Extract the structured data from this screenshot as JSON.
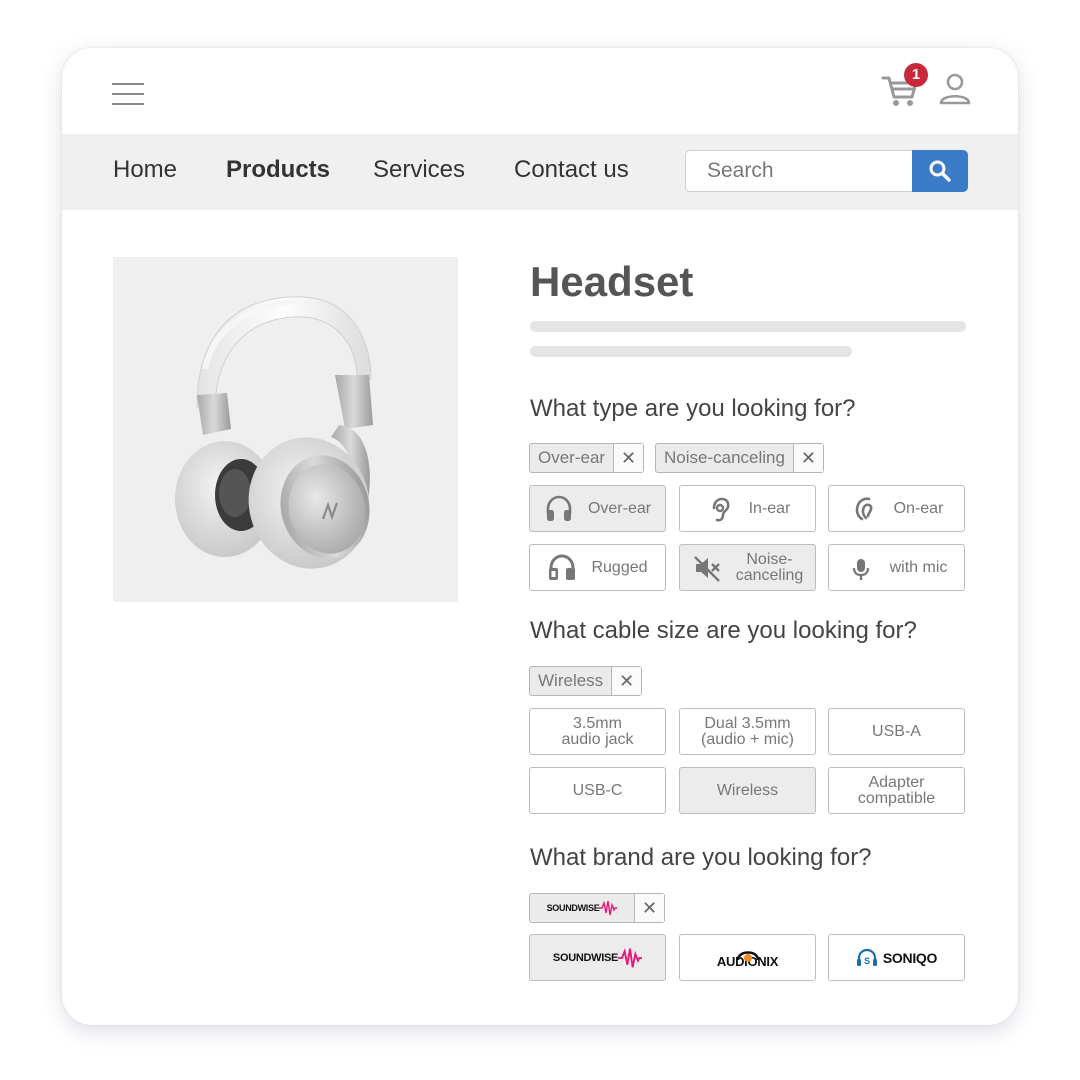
{
  "header": {
    "cart_count": "1"
  },
  "nav": {
    "items": [
      "Home",
      "Products",
      "Services",
      "Contact us"
    ],
    "active": "Products",
    "search_placeholder": "Search"
  },
  "product": {
    "title": "Headset"
  },
  "filters": {
    "type": {
      "question": "What type are you looking for?",
      "chips": [
        "Over-ear",
        "Noise-canceling"
      ],
      "options": [
        {
          "label": "Over-ear",
          "icon": "headphones-icon",
          "selected": true
        },
        {
          "label": "In-ear",
          "icon": "in-ear-icon",
          "selected": false
        },
        {
          "label": "On-ear",
          "icon": "on-ear-icon",
          "selected": false
        },
        {
          "label": "Rugged",
          "icon": "rugged-headphones-icon",
          "selected": false
        },
        {
          "label": "Noise-\ncanceling",
          "icon": "noise-canceling-icon",
          "selected": true
        },
        {
          "label": "with mic",
          "icon": "microphone-icon",
          "selected": false
        }
      ]
    },
    "cable": {
      "question": "What cable size are you looking for?",
      "chips": [
        "Wireless"
      ],
      "options": [
        {
          "label": "3.5mm\naudio jack",
          "selected": false
        },
        {
          "label": "Dual 3.5mm\n(audio + mic)",
          "selected": false
        },
        {
          "label": "USB-A",
          "selected": false
        },
        {
          "label": "USB-C",
          "selected": false
        },
        {
          "label": "Wireless",
          "selected": true
        },
        {
          "label": "Adapter\ncompatible",
          "selected": false
        }
      ]
    },
    "brand": {
      "question": "What brand are you looking for?",
      "chips": [
        "SOUNDWISE"
      ],
      "options": [
        {
          "label": "SOUNDWISE",
          "selected": true
        },
        {
          "label": "AUDIONIX",
          "selected": false
        },
        {
          "label": "SONIQO",
          "selected": false
        }
      ]
    }
  },
  "colors": {
    "accent": "#3a7cc7",
    "badge": "#c8283c",
    "soundwise_wave": "#e6177a",
    "soniqo_blue": "#1a6fa8"
  }
}
